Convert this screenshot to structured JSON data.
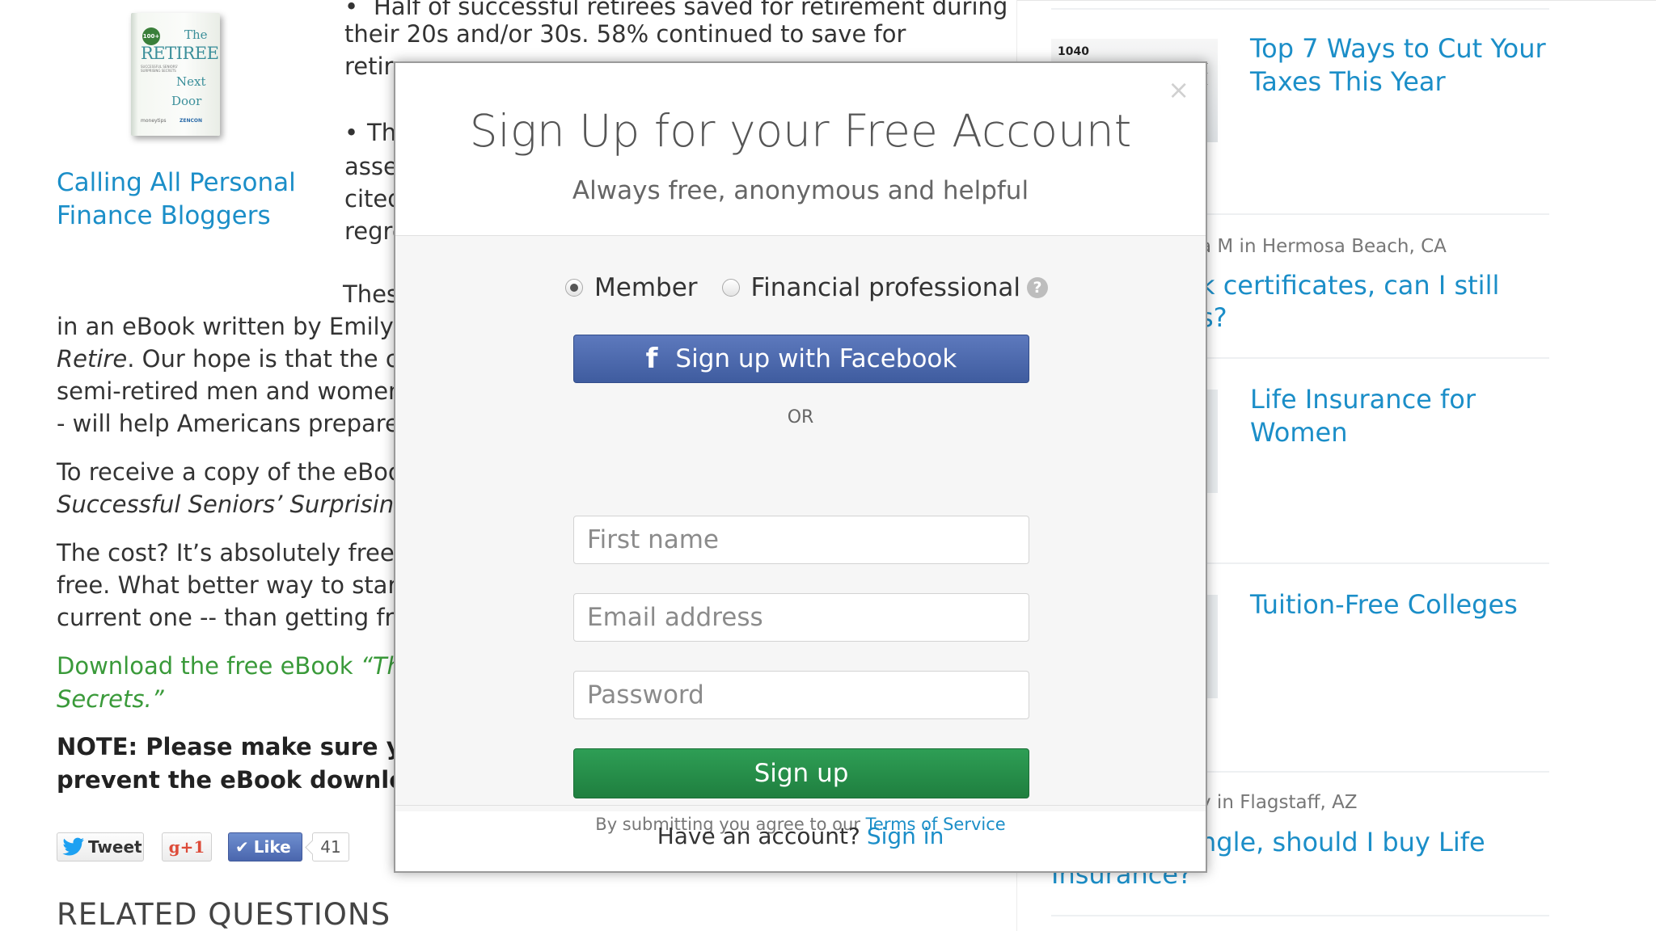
{
  "left": {
    "book": {
      "badge": "100+",
      "line1": "The",
      "line2": "RETIREE",
      "line3": "SUCCESSFUL SENIORS' SURPRISING SECRETS",
      "line4": "Next",
      "line5": "Door",
      "publisher1": "moneytips",
      "publisher2": "ZENCON"
    },
    "promo_link": "Calling All Personal Finance Bloggers",
    "bullet1_line1": "Half of successful retirees saved for retirement during",
    "bullet1_line2": "their 20s and/or 30s. 58% continued to save for",
    "bullet1_line3": "retir",
    "bullet2_line1": "Th",
    "bullet2_line2": "asse",
    "bullet2_line3": "cited",
    "bullet2_line4": "regre",
    "para1_lead": "Thes",
    "para1_line1": "in an eBook written by Emily G",
    "para1_line2_em": "Retire",
    "para1_line2": ". Our hope is that the col",
    "para1_line3": "semi-retired men and women",
    "para1_line4": "- will help Americans prepare f",
    "para2_line1": "To receive a copy of the eBook",
    "para2_line2_em": "Successful Seniors’ Surprising",
    "para3_line1": "The cost? It’s absolutely free! A",
    "para3_line2": "free. What better way to start p",
    "para3_line3": "current one -- than getting free",
    "download_line1": "Download the free eBook ",
    "download_line1_em": "“The",
    "download_line2_em": "Secrets.”",
    "note_line1": "NOTE: Please make sure you d",
    "note_line2": "prevent the eBook download.",
    "social": {
      "tweet": "Tweet",
      "gplus": "g+1",
      "like": "Like",
      "like_count": "41"
    },
    "related_heading": "RELATED QUESTIONS"
  },
  "right": {
    "thumb1_text": "1040",
    "article1": "Top 7 Ways to Cut Your Taxes This Year",
    "q1_meta": "a M in Hermosa Beach, CA",
    "q1_line1": "k certificates, can I still",
    "q1_line2": "s?",
    "article2": "Life Insurance for Women",
    "article3": "Tuition-Free Colleges",
    "q2_meta": "y in Flagstaff, AZ",
    "q2_line1": "ngle, should I buy Life",
    "q2_line2": "Insurance?"
  },
  "modal": {
    "close": "×",
    "title": "Sign Up for your Free Account",
    "subtitle": "Always free, anonymous and helpful",
    "radio_member": "Member",
    "radio_pro": "Financial professional",
    "help": "?",
    "facebook_icon": "f",
    "facebook_label": "Sign up with Facebook",
    "or": "OR",
    "first_name_placeholder": "First name",
    "email_placeholder": "Email address",
    "password_placeholder": "Password",
    "signup_label": "Sign up",
    "terms_prefix": "By submitting you agree to our ",
    "terms_link": "Terms of Service",
    "footer_prefix": "Have an account?",
    "footer_link": "Sign in"
  },
  "colors": {
    "link_blue": "#1b8ec8",
    "facebook_blue": "#3f5c9f",
    "signup_green": "#1f7f3f",
    "download_green": "#3a9a3a"
  },
  "icons": [
    "close-icon",
    "help-icon",
    "facebook-icon",
    "twitter-bird-icon",
    "checkmark-icon"
  ]
}
